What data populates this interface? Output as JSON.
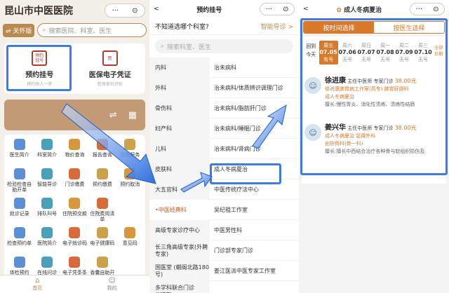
{
  "panel1": {
    "title": "昆山市中医医院",
    "capsule": {
      "more": "···",
      "close": "⊙"
    },
    "old_mode": "⇌ 关怀版",
    "search_placeholder": "搜索医院、科室、医生",
    "card_items": [
      {
        "icon_text": "预约挂号",
        "label": "预约挂号",
        "sub": "预约快人一步"
      },
      {
        "icon_text": "凭证",
        "label": "医保电子凭证",
        "sub": "医保身份识别"
      }
    ],
    "grid": [
      {
        "label": "医生简介",
        "color": "#5b8fd6"
      },
      {
        "label": "科室简介",
        "color": "#4aa0b8"
      },
      {
        "label": "物价查询",
        "color": "#d9963a"
      },
      {
        "label": "报告查询",
        "color": "#d96a3a"
      },
      {
        "label": "住院服务",
        "color": "#c9a24a"
      },
      {
        "label": "检验检查自助开单",
        "color": "#5b8fd6"
      },
      {
        "label": "智能导诊",
        "color": "#4aa0b8"
      },
      {
        "label": "门诊缴费",
        "color": "#d96a3a"
      },
      {
        "label": "预约缴费",
        "color": "#c9a24a"
      },
      {
        "label": "预约取消",
        "color": "#d9963a"
      },
      {
        "label": "就诊记录",
        "color": "#5b8fd6"
      },
      {
        "label": "排队叫号",
        "color": "#4aa0b8"
      },
      {
        "label": "住院预交款",
        "color": "#d9963a"
      },
      {
        "label": "住院费用清单",
        "color": "#d96a3a"
      },
      {
        "label": "",
        "color": "#ffffff"
      },
      {
        "label": "检查预约单",
        "color": "#5b8fd6"
      },
      {
        "label": "医院简介",
        "color": "#4aa0b8"
      },
      {
        "label": "电子就诊码",
        "color": "#d96a3a"
      },
      {
        "label": "电子健康码",
        "color": "#c9a24a"
      },
      {
        "label": "意见码",
        "color": "#d9963a"
      },
      {
        "label": "体检预约",
        "color": "#5b8fd6"
      },
      {
        "label": "在线问诊",
        "color": "#4aa0b8"
      },
      {
        "label": "电子凭条条",
        "color": "#d96a3a"
      },
      {
        "label": "香囊自助开单",
        "color": "#c9a24a"
      },
      {
        "label": "",
        "color": "#ffffff"
      }
    ],
    "tabs": [
      {
        "label": "首页"
      },
      {
        "label": "我的"
      }
    ]
  },
  "panel2": {
    "back": "<",
    "title": "预约挂号",
    "ask": "不知道选哪个科室?",
    "guide": "智能导诊 >",
    "search_placeholder": "搜索科室、医生",
    "left": [
      "内科",
      "外科",
      "骨伤科",
      "妇产科",
      "儿科",
      "皮肤科",
      "大五官科",
      "中医经典科",
      "高级专家诊疗中心",
      "长三角高级专家(外聘专家)",
      "国医堂 (樾阁北路180号)",
      "多学科联合门诊(MDT)"
    ],
    "right": [
      "治未病科",
      "治未病科/体质辨识调理门诊",
      "治未病科/脂肪肝门诊",
      "治未病科/睡眠门诊",
      "治未病科/肾病门诊",
      "成人冬病夏治",
      "中医传统疗法中心",
      "吴纪祖工作室",
      "中医男性科",
      "门诊部专家门诊",
      "娄江医派中医专家工作室"
    ]
  },
  "panel3": {
    "back": "<",
    "title": "成人冬病夏治",
    "tab_time": "按时间选择",
    "tab_doctor": "按医生选择",
    "back_today_1": "回到",
    "back_today_2": "今天",
    "dates": [
      {
        "week": "周五",
        "day": "07.05",
        "status": "有号",
        "on": true
      },
      {
        "week": "周六",
        "day": "07.06",
        "status": "无号",
        "on": false
      },
      {
        "week": "周日",
        "day": "07.07",
        "status": "无号",
        "on": false
      },
      {
        "week": "周一",
        "day": "07.08",
        "status": "无号",
        "on": false
      },
      {
        "week": "周二",
        "day": "07.09",
        "status": "无号",
        "on": false
      },
      {
        "week": "周三",
        "day": "07.10",
        "status": "无号",
        "on": false
      }
    ],
    "all_dates": "全部日期",
    "doctors": [
      {
        "name": "徐进康",
        "title": "主任中医师 专家门诊",
        "price": "38.00元",
        "dept": "徐进康脾胃病工作室(高专)  脾胃肝胆科",
        "specialty": "成人冬病夏治",
        "skill": "擅长:慢性胃炎、消化性溃疡、溃疡性结肠"
      },
      {
        "name": "姜兴华",
        "title": "主任中医师 专家门诊",
        "price": "38.00元",
        "dept": "成人冬病夏治  足踝外科",
        "specialty": "创伤骨科(骨一科)",
        "skill": "擅长:擅长中西结合治疗各种骨与软组织损伤及"
      }
    ]
  }
}
